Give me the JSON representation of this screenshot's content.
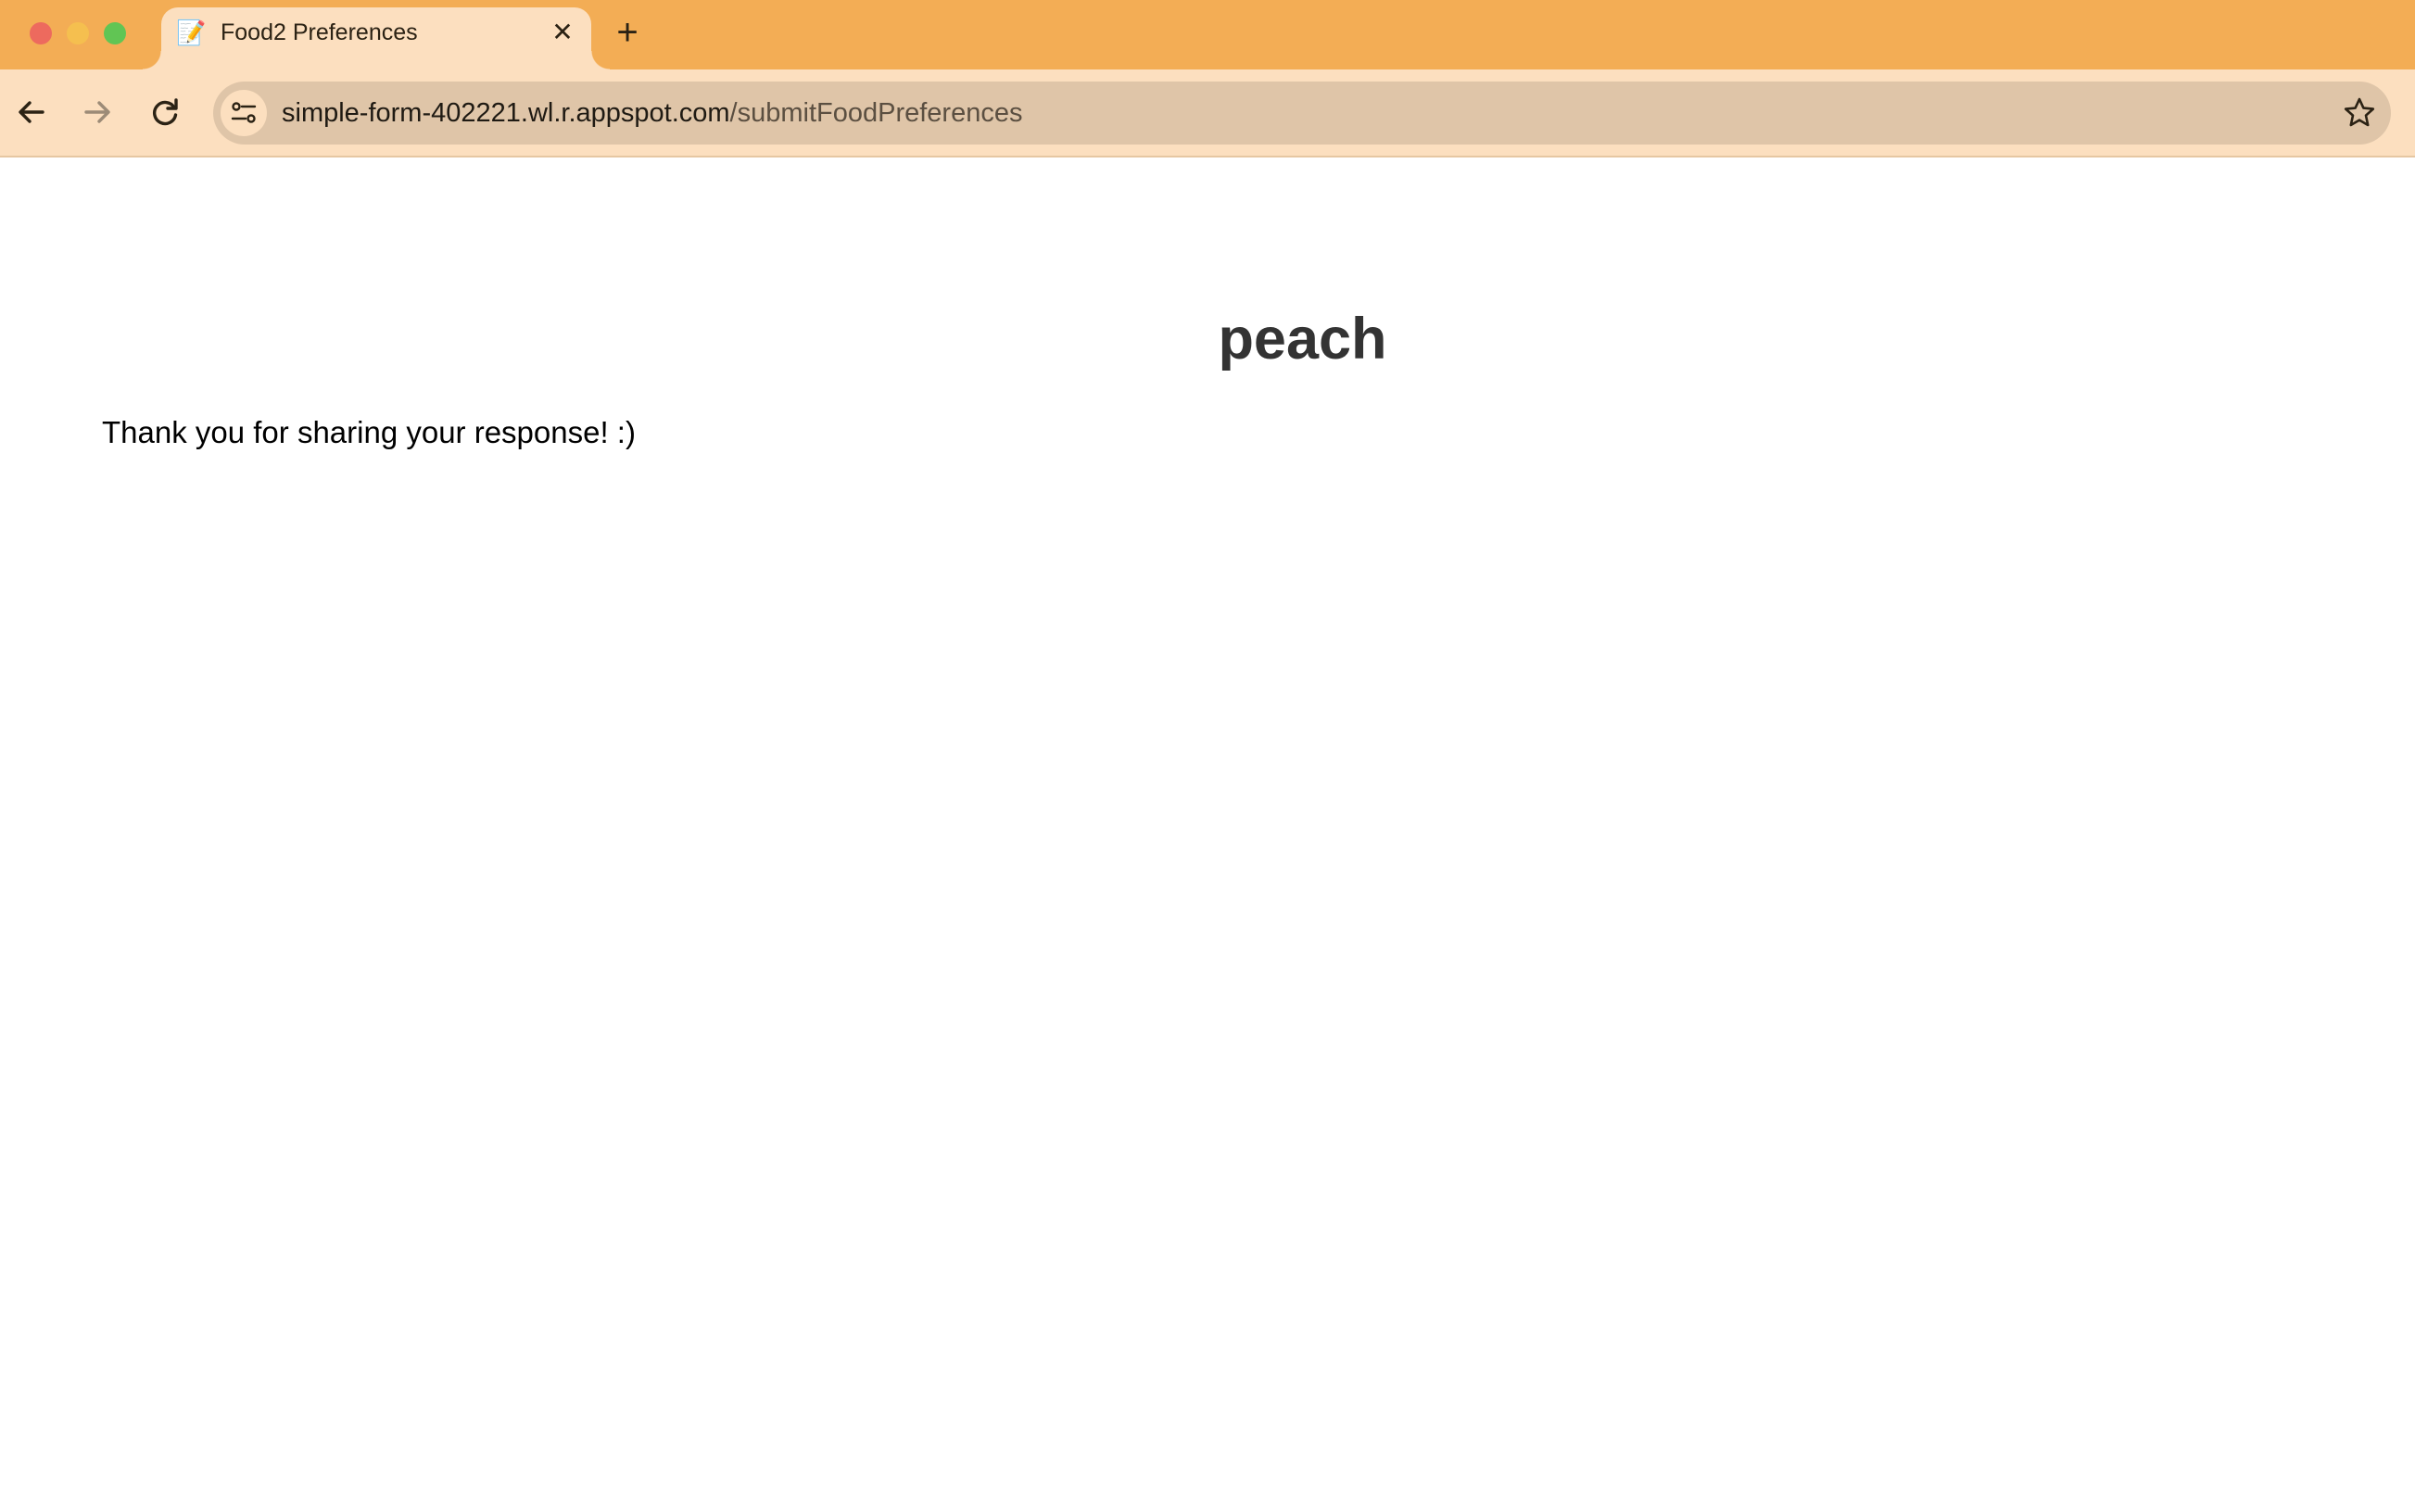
{
  "browser": {
    "tab": {
      "favicon": "memo-icon",
      "favicon_glyph": "📝",
      "title": "Food2 Preferences",
      "close_glyph": "✕"
    },
    "new_tab_glyph": "+",
    "address_bar": {
      "host": "simple-form-402221.wl.r.appspot.com",
      "path": "/submitFoodPreferences"
    },
    "colors": {
      "tabstrip": "#f3ad55",
      "toolbar": "#fcdfbf",
      "omnibox": "#dfc5a8"
    }
  },
  "page": {
    "heading": "peach",
    "message": "Thank you for sharing your response! :)"
  }
}
